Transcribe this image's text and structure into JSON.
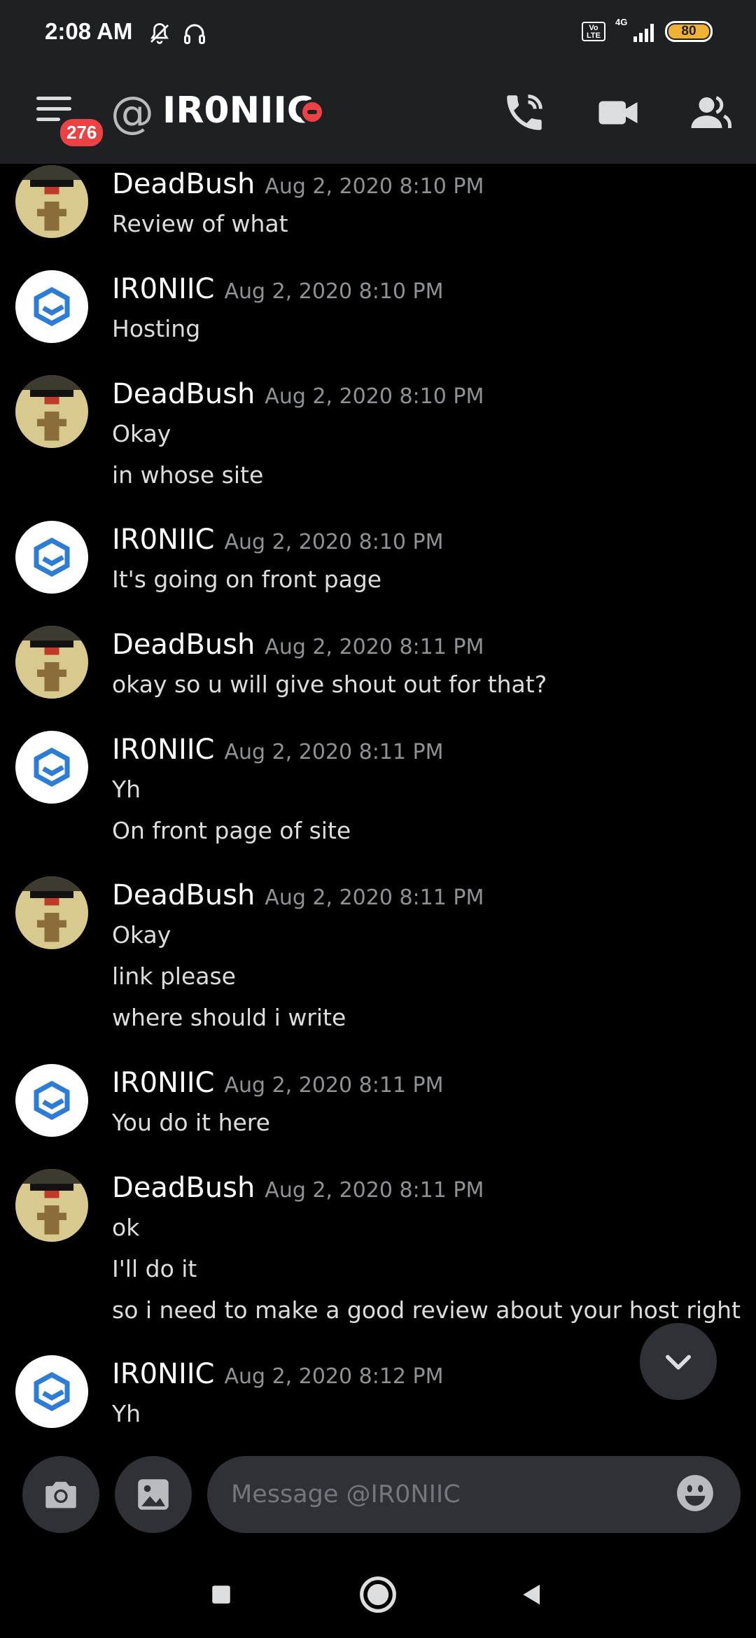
{
  "status": {
    "time": "2:08 AM",
    "network": "4G",
    "volte": "Vo LTE",
    "battery": "80"
  },
  "header": {
    "unread_badge": "276",
    "at_symbol": "@",
    "title": "IR0NIIC",
    "status_color": "#ed4245"
  },
  "messages": [
    {
      "author": "DeadBush",
      "timestamp": "Aug 2, 2020 8:10 PM",
      "avatar": "deadbush-avatar",
      "lines": [
        "Review of what"
      ]
    },
    {
      "author": "IR0NIIC",
      "timestamp": "Aug 2, 2020 8:10 PM",
      "avatar": "ironiic-avatar",
      "lines": [
        "Hosting"
      ]
    },
    {
      "author": "DeadBush",
      "timestamp": "Aug 2, 2020 8:10 PM",
      "avatar": "deadbush-avatar",
      "lines": [
        "Okay",
        "in whose site"
      ]
    },
    {
      "author": "IR0NIIC",
      "timestamp": "Aug 2, 2020 8:10 PM",
      "avatar": "ironiic-avatar",
      "lines": [
        "It's going on front page"
      ]
    },
    {
      "author": "DeadBush",
      "timestamp": "Aug 2, 2020 8:11 PM",
      "avatar": "deadbush-avatar",
      "lines": [
        "okay so u will give shout out for that?"
      ]
    },
    {
      "author": "IR0NIIC",
      "timestamp": "Aug 2, 2020 8:11 PM",
      "avatar": "ironiic-avatar",
      "lines": [
        "Yh",
        "On front page of site"
      ]
    },
    {
      "author": "DeadBush",
      "timestamp": "Aug 2, 2020 8:11 PM",
      "avatar": "deadbush-avatar",
      "lines": [
        "Okay",
        "link please",
        "where should i write"
      ]
    },
    {
      "author": "IR0NIIC",
      "timestamp": "Aug 2, 2020 8:11 PM",
      "avatar": "ironiic-avatar",
      "lines": [
        "You do it here"
      ]
    },
    {
      "author": "DeadBush",
      "timestamp": "Aug 2, 2020 8:11 PM",
      "avatar": "deadbush-avatar",
      "lines": [
        "ok",
        "I'll do it",
        "so i need to make a good review about your host right"
      ]
    },
    {
      "author": "IR0NIIC",
      "timestamp": "Aug 2, 2020 8:12 PM",
      "avatar": "ironiic-avatar",
      "lines": [
        "Yh"
      ]
    }
  ],
  "input": {
    "placeholder": "Message @IR0NIIC"
  },
  "colors": {
    "header_bg": "#1f2023",
    "chat_bg": "#000000",
    "input_bg": "#2f3136",
    "ironiic_avatar_accent": "#2d7cd6",
    "badge": "#ed4245"
  }
}
